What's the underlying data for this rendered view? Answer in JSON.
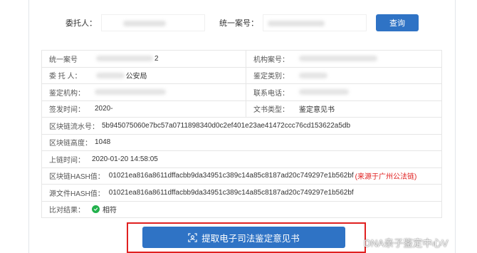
{
  "search": {
    "client_label": "委托人：",
    "case_label": "统一案号：",
    "query_button": "查询"
  },
  "details": {
    "row1": {
      "left_key": "统一案号",
      "left_value_suffix": "2",
      "right_key": "机构案号："
    },
    "row2": {
      "left_key": "委 托 人：",
      "left_value": "公安局",
      "right_key": "鉴定类别："
    },
    "row3": {
      "left_key": "鉴定机构：",
      "right_key": "联系电话："
    },
    "row4": {
      "left_key": "签发时间：",
      "left_value": "2020-",
      "right_key": "文书类型：",
      "right_value": "鉴定意见书"
    },
    "chain_serial": {
      "key": "区块链流水号：",
      "value": "5b945075060e7bc57a0711898340d0c2ef401e23ae41472ccc76cd153622a5db"
    },
    "chain_height": {
      "key": "区块链高度：",
      "value": "1048"
    },
    "chain_time": {
      "key": "上链时间：",
      "value": "2020-01-20 14:58:05"
    },
    "chain_hash": {
      "key": "区块链HASH值：",
      "value": "01021ea816a8611dffacbb9da34951c389c14a85c8187ad20c749297e1b562bf",
      "note": "(来源于广州公法链)"
    },
    "file_hash": {
      "key": "源文件HASH值：",
      "value": "01021ea816a8611dffacbb9da34951c389c14a85c8187ad20c749297e1b562bf"
    },
    "compare": {
      "key": "比对结果：",
      "value": "相符"
    }
  },
  "extract_button": "提取电子司法鉴定意见书",
  "watermark": "DNA亲子鉴定中心V",
  "colors": {
    "primary": "#2f73c5",
    "highlight_frame": "#e02020",
    "ok": "#22b14c"
  },
  "icons": {
    "extract": "scan-icon",
    "ok": "check-circle-icon",
    "watermark": "weibo-icon"
  }
}
